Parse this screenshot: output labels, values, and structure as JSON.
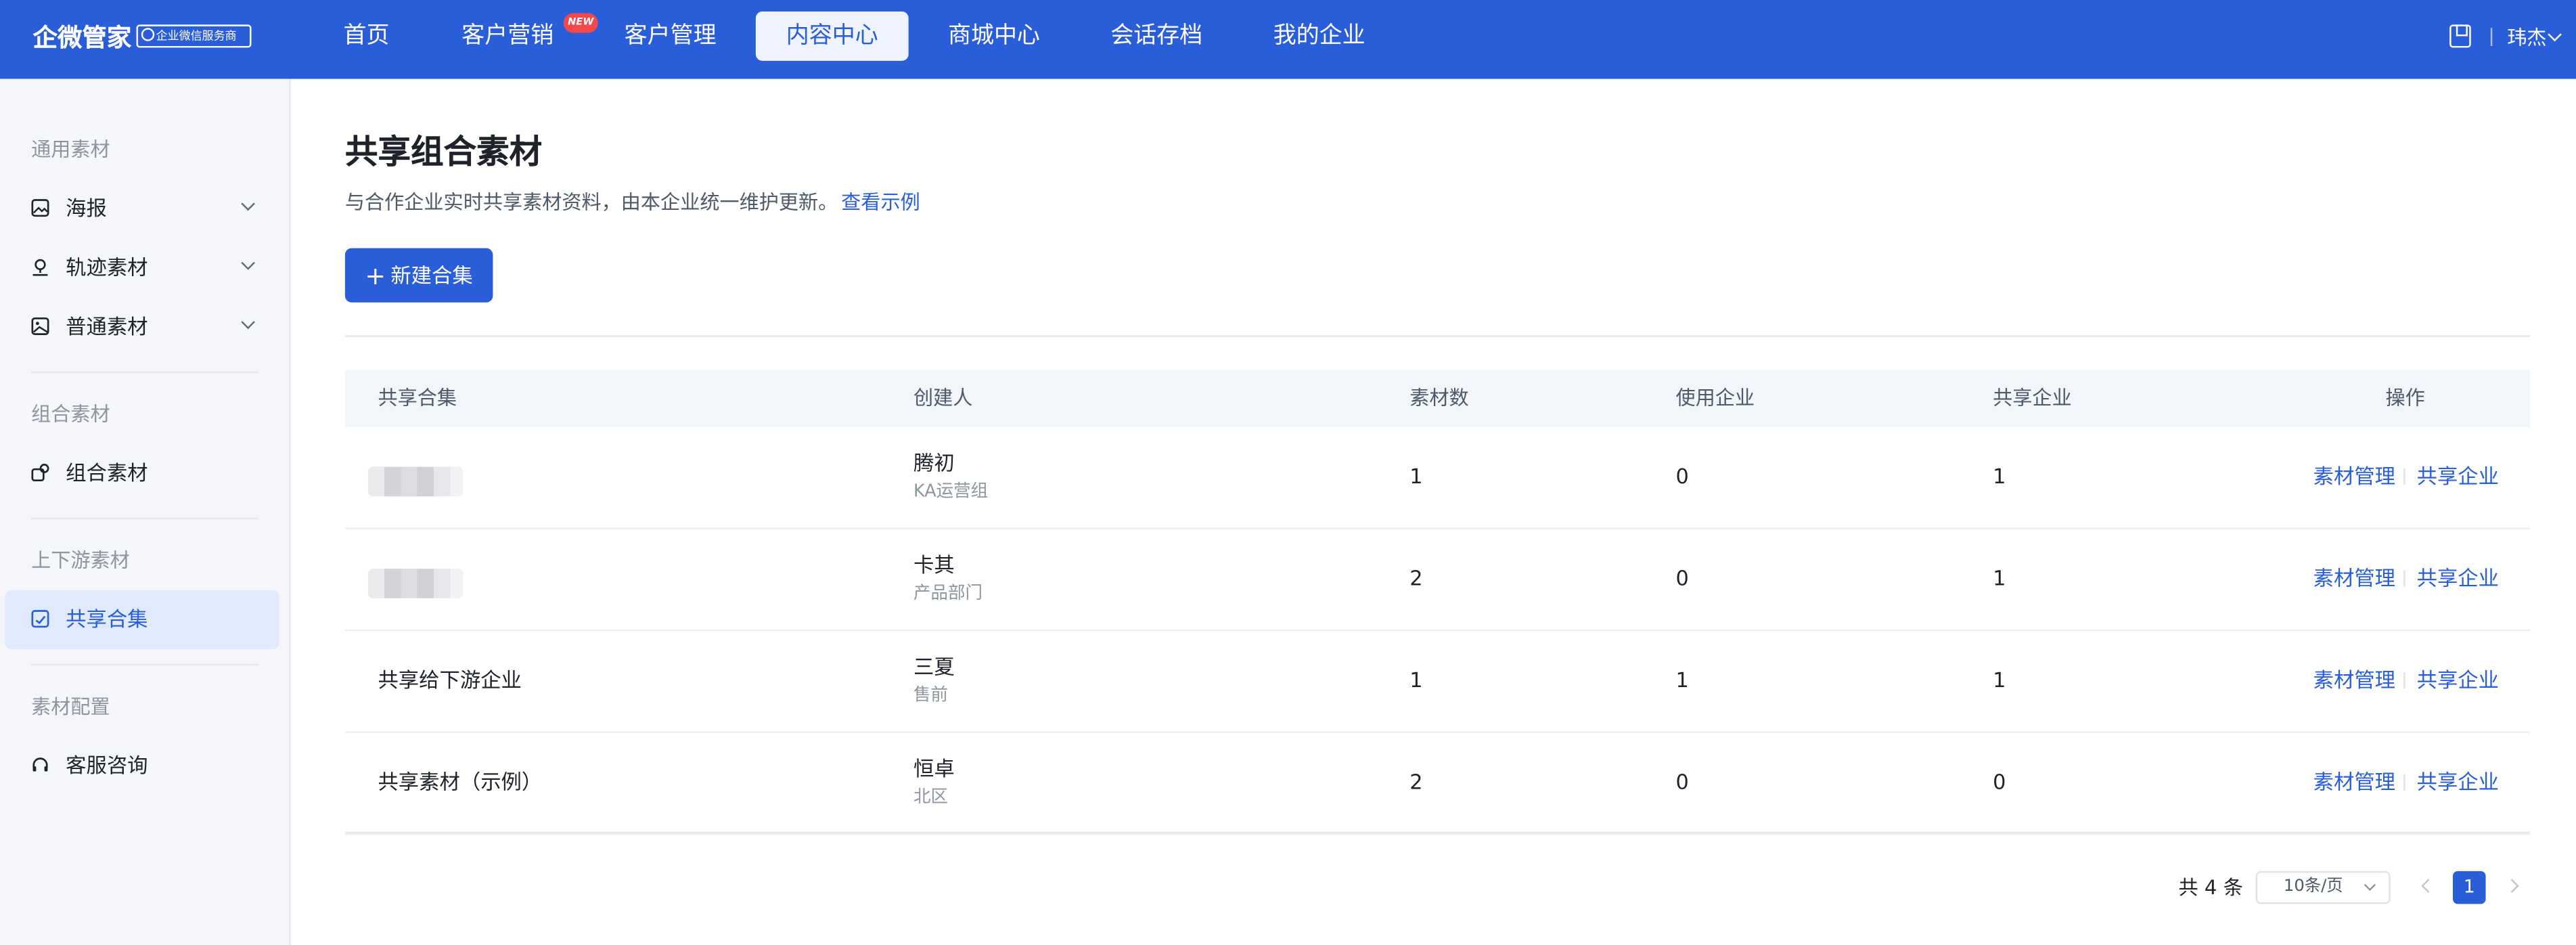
{
  "header": {
    "brand": "企微管家",
    "brand_badge": "企业微信服务商",
    "nav": [
      {
        "label": "首页"
      },
      {
        "label": "客户营销",
        "tag": "NEW"
      },
      {
        "label": "客户管理"
      },
      {
        "label": "内容中心",
        "active": true
      },
      {
        "label": "商城中心"
      },
      {
        "label": "会话存档"
      },
      {
        "label": "我的企业"
      }
    ],
    "user_name": "玮杰",
    "user_icon": "chevron-down-icon",
    "help_icon": "book-icon"
  },
  "sidebar": {
    "groups": [
      {
        "title": "通用素材",
        "items": [
          {
            "label": "海报",
            "icon": "image-icon",
            "expandable": true
          },
          {
            "label": "轨迹素材",
            "icon": "track-icon",
            "expandable": true
          },
          {
            "label": "普通素材",
            "icon": "picture-icon",
            "expandable": true
          }
        ]
      },
      {
        "title": "组合素材",
        "items": [
          {
            "label": "组合素材",
            "icon": "combo-icon"
          }
        ]
      },
      {
        "title": "上下游素材",
        "items": [
          {
            "label": "共享合集",
            "icon": "share-icon",
            "active": true
          }
        ]
      },
      {
        "title": "素材配置",
        "items": [
          {
            "label": "客服咨询",
            "icon": "headset-icon"
          }
        ]
      }
    ]
  },
  "main": {
    "title": "共享组合素材",
    "description": "与合作企业实时共享素材资料，由本企业统一维护更新。",
    "example_link": "查看示例",
    "create_button": "新建合集",
    "table": {
      "columns": [
        "共享合集",
        "创建人",
        "素材数",
        "使用企业",
        "共享企业",
        "操作"
      ],
      "rows": [
        {
          "name": "",
          "name_blurred": true,
          "creator": "腾初",
          "department": "KA运营组",
          "materials": "1",
          "using": "0",
          "sharing": "1",
          "action1": "素材管理",
          "action2": "共享企业"
        },
        {
          "name": "",
          "name_blurred": true,
          "creator": "卡其",
          "department": "产品部门",
          "materials": "2",
          "using": "0",
          "sharing": "1",
          "action1": "素材管理",
          "action2": "共享企业"
        },
        {
          "name": "共享给下游企业",
          "name_blurred": false,
          "creator": "三夏",
          "department": "售前",
          "materials": "1",
          "using": "1",
          "sharing": "1",
          "action1": "素材管理",
          "action2": "共享企业"
        },
        {
          "name": "共享素材（示例）",
          "name_blurred": false,
          "creator": "恒卓",
          "department": "北区",
          "materials": "2",
          "using": "0",
          "sharing": "0",
          "action1": "素材管理",
          "action2": "共享企业"
        }
      ]
    },
    "pagination": {
      "total": "共 4 条",
      "page_size": "10条/页",
      "current_page": "1"
    }
  }
}
